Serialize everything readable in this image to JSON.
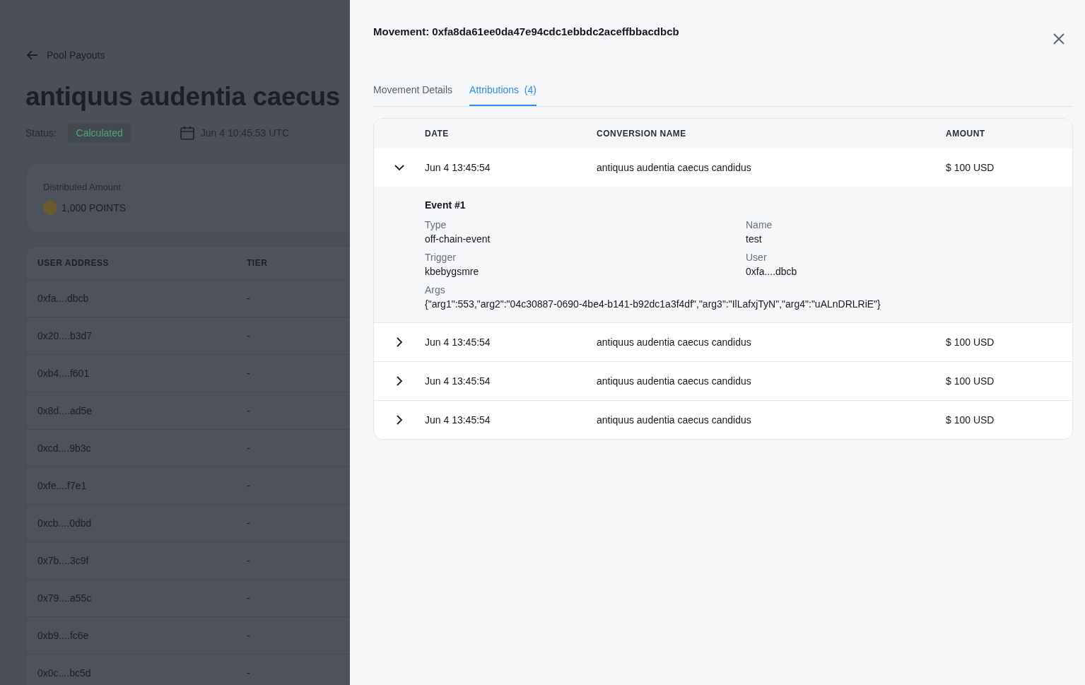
{
  "page": {
    "back_link": "Pool Payouts",
    "title": "antiquus audentia caecus",
    "status_label": "Status:",
    "status": "Calculated",
    "date": "Jun 4 10:45:53 UTC",
    "summary": {
      "label": "Distributed Amount",
      "value": "1,000 POINTS"
    },
    "table": {
      "columns": [
        "USER ADDRESS",
        "TIER"
      ],
      "rows": [
        {
          "address": "0xfa....dbcb",
          "tier": "-"
        },
        {
          "address": "0x20....b3d7",
          "tier": "-"
        },
        {
          "address": "0xb4....f601",
          "tier": "-"
        },
        {
          "address": "0x8d....ad5e",
          "tier": "-"
        },
        {
          "address": "0xcd....9b3c",
          "tier": "-"
        },
        {
          "address": "0xfe....f7e1",
          "tier": "-"
        },
        {
          "address": "0xcb....0dbd",
          "tier": "-"
        },
        {
          "address": "0x7b....3c9f",
          "tier": "-"
        },
        {
          "address": "0x79....a55c",
          "tier": "-"
        },
        {
          "address": "0xb9....fc6e",
          "tier": "-"
        },
        {
          "address": "0x0c....bc5d",
          "tier": "-"
        }
      ]
    }
  },
  "drawer": {
    "title": "Movement: 0xfa8da61ee0da47e94cdc1ebbdc2aceffbbacdbcb",
    "tabs": [
      {
        "label": "Movement Details",
        "selected": false
      },
      {
        "label": "Attributions",
        "count": "(4)",
        "selected": true
      }
    ],
    "table": {
      "columns": [
        "DATE",
        "CONVERSION NAME",
        "AMOUNT"
      ],
      "rows": [
        {
          "date": "Jun 4 13:45:54",
          "name": "antiquus audentia caecus candidus",
          "amount": "$ 100 USD",
          "expanded": true,
          "details": {
            "heading": "Event #1",
            "fields": [
              {
                "label": "Type",
                "value": "off-chain-event"
              },
              {
                "label": "Name",
                "value": "test"
              },
              {
                "label": "Trigger",
                "value": "kbebygsmre"
              },
              {
                "label": "User",
                "value": "0xfa....dbcb"
              },
              {
                "label": "Args",
                "value": "{\"arg1\":553,\"arg2\":\"04c30887-0690-4be4-b141-b92dc1a3f4df\",\"arg3\":\"IlLafxjTyN\",\"arg4\":\"uALnDRLRiE\"}"
              }
            ]
          }
        },
        {
          "date": "Jun 4 13:45:54",
          "name": "antiquus audentia caecus candidus",
          "amount": "$ 100 USD",
          "expanded": false
        },
        {
          "date": "Jun 4 13:45:54",
          "name": "antiquus audentia caecus candidus",
          "amount": "$ 100 USD",
          "expanded": false
        },
        {
          "date": "Jun 4 13:45:54",
          "name": "antiquus audentia caecus candidus",
          "amount": "$ 100 USD",
          "expanded": false
        }
      ]
    }
  }
}
